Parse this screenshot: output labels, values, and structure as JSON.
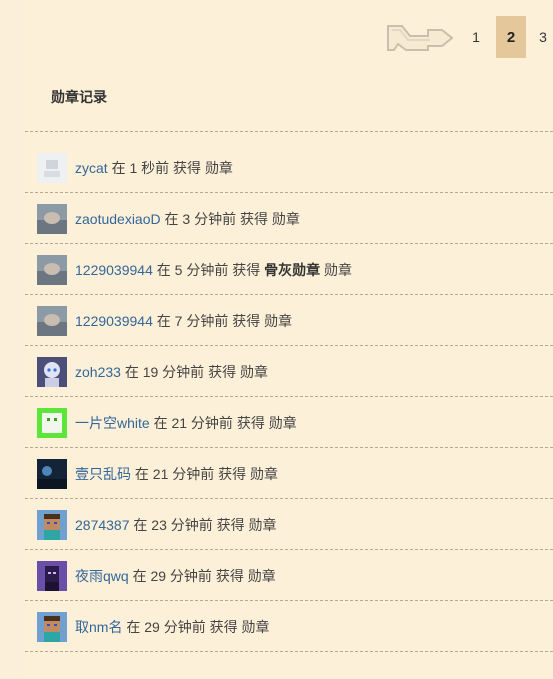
{
  "pagination": {
    "pages": [
      "1",
      "2",
      "3"
    ],
    "current": "2"
  },
  "section": {
    "title": "勋章记录"
  },
  "text": {
    "at": "在",
    "got": "获得",
    "badge": "勋章"
  },
  "records": [
    {
      "user": "zycat",
      "time": "1 秒前",
      "medal": "",
      "avatar_icon": "default-avatar-icon"
    },
    {
      "user": "zaotudexiaoD",
      "time": "3 分钟前",
      "medal": "",
      "avatar_icon": "photo-avatar-icon"
    },
    {
      "user": "1229039944",
      "time": "5 分钟前",
      "medal": "骨灰勋章",
      "avatar_icon": "photo-avatar-icon"
    },
    {
      "user": "1229039944",
      "time": "7 分钟前",
      "medal": "",
      "avatar_icon": "photo-avatar-icon"
    },
    {
      "user": "zoh233",
      "time": "19 分钟前",
      "medal": "",
      "avatar_icon": "anime-avatar-icon"
    },
    {
      "user": "一片空white",
      "time": "21 分钟前",
      "medal": "",
      "avatar_icon": "green-avatar-icon"
    },
    {
      "user": "壹只乱码",
      "time": "21 分钟前",
      "medal": "",
      "avatar_icon": "dark-avatar-icon"
    },
    {
      "user": "2874387",
      "time": "23 分钟前",
      "medal": "",
      "avatar_icon": "minecraft-steve-icon"
    },
    {
      "user": "夜雨qwq",
      "time": "29 分钟前",
      "medal": "",
      "avatar_icon": "purple-avatar-icon"
    },
    {
      "user": "取nm名",
      "time": "29 分钟前",
      "medal": "",
      "avatar_icon": "minecraft-steve-icon"
    }
  ]
}
